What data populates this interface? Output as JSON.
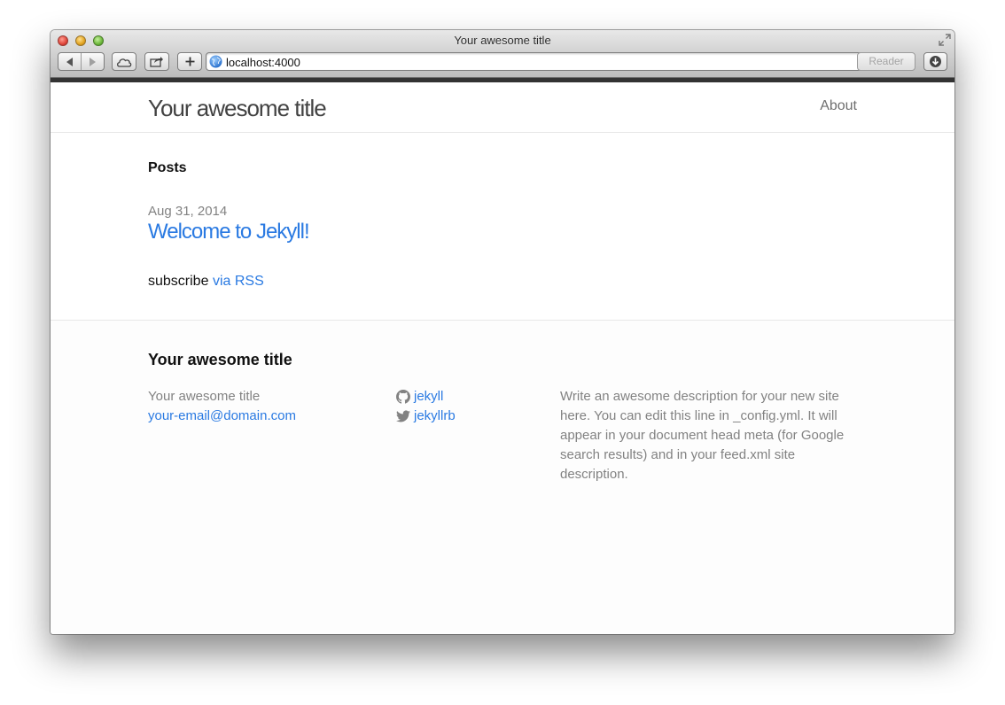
{
  "window": {
    "title": "Your awesome title",
    "url": "localhost:4000",
    "reader_label": "Reader"
  },
  "header": {
    "site_title": "Your awesome title",
    "nav": [
      {
        "label": "About"
      }
    ]
  },
  "main": {
    "posts_heading": "Posts",
    "posts": [
      {
        "date": "Aug 31, 2014",
        "title": "Welcome to Jekyll!"
      }
    ],
    "subscribe_text": "subscribe",
    "rss_link": "via RSS"
  },
  "footer": {
    "heading": "Your awesome title",
    "name": "Your awesome title",
    "email": "your-email@domain.com",
    "social": [
      {
        "icon": "github-icon",
        "label": "jekyll"
      },
      {
        "icon": "twitter-icon",
        "label": "jekyllrb"
      }
    ],
    "description": "Write an awesome description for your new site here. You can edit this line in _config.yml. It will appear in your document head meta (for Google search results) and in your feed.xml site description."
  },
  "colors": {
    "link": "#2a7ae2",
    "muted": "#828282",
    "header_bar": "#333333"
  }
}
